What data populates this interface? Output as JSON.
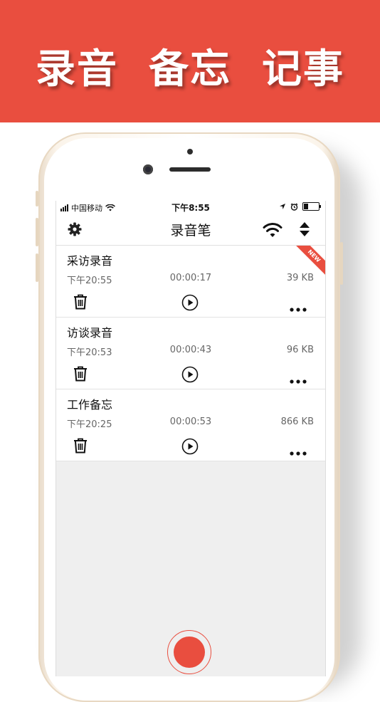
{
  "banner": {
    "title": "录音  备忘  记事"
  },
  "status_bar": {
    "carrier": "中国移动",
    "time": "下午8:55"
  },
  "nav": {
    "title": "录音笔",
    "settings_icon": "gear-icon",
    "wifi_icon": "wifi-icon",
    "sort_icon": "sort-icon"
  },
  "recordings": [
    {
      "title": "采访录音",
      "date": "下午20:55",
      "duration": "00:00:17",
      "size": "39 KB",
      "badge": "NEW"
    },
    {
      "title": "访谈录音",
      "date": "下午20:53",
      "duration": "00:00:43",
      "size": "96 KB"
    },
    {
      "title": "工作备忘",
      "date": "下午20:25",
      "duration": "00:00:53",
      "size": "866 KB"
    }
  ],
  "colors": {
    "accent": "#e94e3f",
    "text": "#111111",
    "muted": "#666666",
    "screen_bg": "#efefef"
  }
}
